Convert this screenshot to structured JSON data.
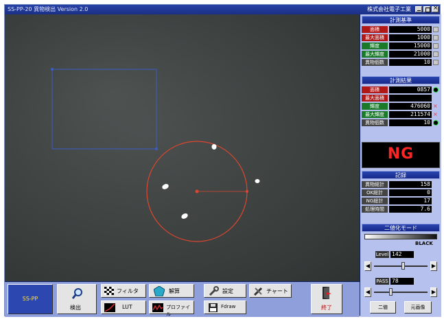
{
  "window": {
    "title": "SS-PP-20 異物検出 Version 2.0",
    "company": "株式会社電子工業"
  },
  "measure_settings": {
    "header": "計測基準",
    "rows": [
      {
        "label": "面積",
        "value": "5000",
        "label_color": "red",
        "indicator": "gray"
      },
      {
        "label": "最大面積",
        "value": "1000",
        "label_color": "red",
        "indicator": "gray"
      },
      {
        "label": "輝度",
        "value": "15000",
        "label_color": "green",
        "indicator": "gray"
      },
      {
        "label": "最大輝度",
        "value": "21000",
        "label_color": "green",
        "indicator": "gray"
      },
      {
        "label": "異物個数",
        "value": "10",
        "label_color": "gray",
        "indicator": "gray"
      }
    ]
  },
  "measure_result": {
    "header": "計測結果",
    "rows": [
      {
        "label": "面積",
        "value": "0857",
        "label_color": "red",
        "indicator": "green",
        "indicator_text": ""
      },
      {
        "label": "最大面積",
        "value": "",
        "label_color": "red",
        "indicator": "none",
        "indicator_text": ""
      },
      {
        "label": "輝度",
        "value": "476060",
        "label_color": "green",
        "indicator": "red",
        "indicator_text": "×"
      },
      {
        "label": "最大輝度",
        "value": "211574",
        "label_color": "green",
        "indicator": "red",
        "indicator_text": "×"
      },
      {
        "label": "異物個数",
        "value": "10",
        "label_color": "gray",
        "indicator": "green",
        "indicator_text": ""
      }
    ],
    "judgement": "NG"
  },
  "records": {
    "header": "記録",
    "rows": [
      {
        "label": "異物総計",
        "value": "158"
      },
      {
        "label": "OK総計",
        "value": "0"
      },
      {
        "label": "NG総計",
        "value": "17"
      },
      {
        "label": "処理時間",
        "value": "7.6"
      }
    ]
  },
  "binary_mode": {
    "header": "二値化モード",
    "gradient_label": "BLACK",
    "level_label": "Level",
    "level_value": "142",
    "pass_label": "PASS",
    "pass_value": "78",
    "level_fraction": 0.55,
    "pass_fraction": 0.3,
    "btn_mode": "二値",
    "btn_image": "元画像"
  },
  "toolbar": {
    "logo": "SS-PP",
    "detect": "検出",
    "filter": "フィルタ",
    "calc": "解算",
    "settings": "設定",
    "chart": "チャート",
    "lut": "LUT",
    "profile": "プロファイル",
    "file": "Fdraw",
    "exit": "終了"
  },
  "colors": {
    "roi_box": "#3a5cc8",
    "circle": "#e0452e",
    "ng_text": "#ff2525"
  }
}
